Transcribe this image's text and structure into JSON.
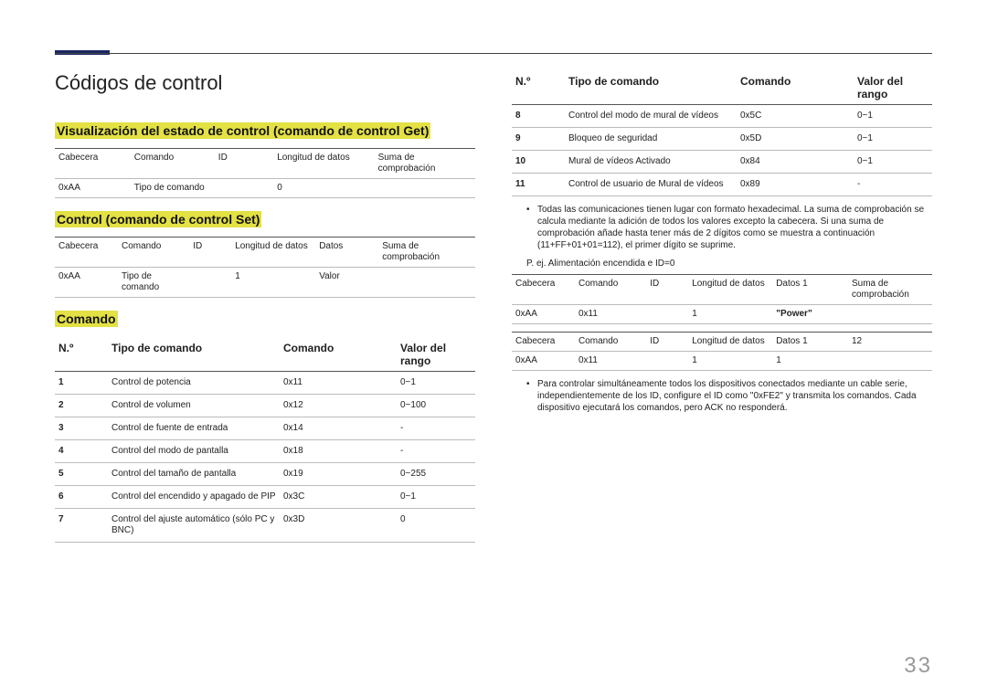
{
  "page_number": "33",
  "titles": {
    "main": "Códigos de control",
    "get": "Visualización del estado de control (comando de control Get)",
    "set": "Control (comando de control Set)",
    "comando": "Comando"
  },
  "get_table": {
    "headers": [
      "Cabecera",
      "Comando",
      "ID",
      "Longitud de datos",
      "Suma de comprobación"
    ],
    "row": [
      "0xAA",
      "Tipo de comando",
      "",
      "0",
      ""
    ]
  },
  "set_table": {
    "headers": [
      "Cabecera",
      "Comando",
      "ID",
      "Longitud de datos",
      "Datos",
      "Suma de comprobación"
    ],
    "row": [
      "0xAA",
      "Tipo de comando",
      "",
      "1",
      "Valor",
      ""
    ]
  },
  "cmd_headers": {
    "no": "N.º",
    "tipo": "Tipo de comando",
    "com": "Comando",
    "val": "Valor del rango"
  },
  "commands_left": [
    {
      "no": "1",
      "tipo": "Control de potencia",
      "com": "0x11",
      "val": "0~1"
    },
    {
      "no": "2",
      "tipo": "Control de volumen",
      "com": "0x12",
      "val": "0~100"
    },
    {
      "no": "3",
      "tipo": "Control de fuente de entrada",
      "com": "0x14",
      "val": "-"
    },
    {
      "no": "4",
      "tipo": "Control del modo de pantalla",
      "com": "0x18",
      "val": "-"
    },
    {
      "no": "5",
      "tipo": "Control del tamaño de pantalla",
      "com": "0x19",
      "val": "0~255"
    },
    {
      "no": "6",
      "tipo": "Control del encendido y apagado de PIP",
      "com": "0x3C",
      "val": "0~1"
    },
    {
      "no": "7",
      "tipo": "Control del ajuste automático (sólo PC y BNC)",
      "com": "0x3D",
      "val": "0"
    }
  ],
  "commands_right": [
    {
      "no": "8",
      "tipo": "Control del modo de mural de vídeos",
      "com": "0x5C",
      "val": "0~1"
    },
    {
      "no": "9",
      "tipo": "Bloqueo de seguridad",
      "com": "0x5D",
      "val": "0~1"
    },
    {
      "no": "10",
      "tipo": "Mural de vídeos Activado",
      "com": "0x84",
      "val": "0~1"
    },
    {
      "no": "11",
      "tipo": "Control de usuario de Mural de vídeos",
      "com": "0x89",
      "val": "-"
    }
  ],
  "bullets": {
    "b1": "Todas las comunicaciones tienen lugar con formato hexadecimal. La suma de comprobación se calcula mediante la adición de todos los valores excepto la cabecera. Si una suma de comprobación añade hasta tener más de 2 dígitos como se muestra a continuación (11+FF+01+01=112), el primer dígito se suprime.",
    "b2": "Para controlar simultáneamente todos los dispositivos conectados mediante un cable serie, independientemente de los ID, configure el ID como \"0xFE2\" y transmita los comandos. Cada dispositivo ejecutará los comandos, pero ACK no responderá."
  },
  "example_note": "P. ej. Alimentación encendida e ID=0",
  "ex_table_a": {
    "headers": [
      "Cabecera",
      "Comando",
      "ID",
      "Longitud de datos",
      "Datos 1",
      "Suma de comprobación"
    ],
    "row": [
      "0xAA",
      "0x11",
      "",
      "1",
      "Power",
      ""
    ]
  },
  "ex_table_b": {
    "headers": [
      "Cabecera",
      "Comando",
      "ID",
      "Longitud de datos",
      "Datos 1",
      "12"
    ],
    "row": [
      "0xAA",
      "0x11",
      "",
      "1",
      "1",
      ""
    ]
  }
}
